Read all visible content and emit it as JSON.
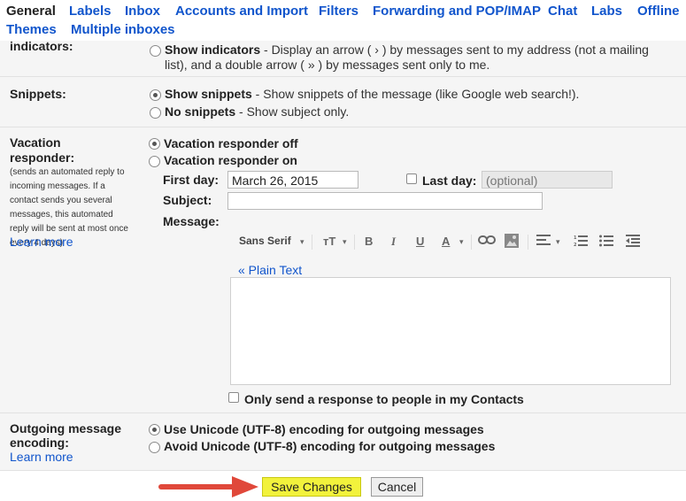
{
  "tabs": [
    {
      "label": "General",
      "active": true
    },
    {
      "label": "Labels"
    },
    {
      "label": "Inbox"
    },
    {
      "label": "Accounts and Import"
    },
    {
      "label": "Filters"
    },
    {
      "label": "Forwarding and POP/IMAP"
    },
    {
      "label": "Chat"
    },
    {
      "label": "Labs"
    },
    {
      "label": "Offline"
    },
    {
      "label": "Themes"
    },
    {
      "label": "Multiple inboxes"
    }
  ],
  "indicators": {
    "label": "indicators:",
    "option_title": "Show indicators",
    "option_desc_line1": " - Display an arrow ( › ) by messages sent to my address (not a mailing",
    "option_desc_line2": "list), and a double arrow ( » ) by messages sent only to me."
  },
  "snippets": {
    "label": "Snippets:",
    "show_title": "Show snippets",
    "show_desc": " - Show snippets of the message (like Google web search!).",
    "no_title": "No snippets",
    "no_desc": " - Show subject only."
  },
  "vacation": {
    "label_line1": "Vacation",
    "label_line2": "responder:",
    "help": "(sends an automated reply to incoming messages. If a contact sends you several messages, this automated reply will be sent at most once every 4 days)",
    "learn_more": "Learn more",
    "off_label": "Vacation responder off",
    "on_label": "Vacation responder on",
    "first_day_label": "First day:",
    "first_day_value": "March 26, 2015",
    "last_day_label": "Last day:",
    "last_day_placeholder": "(optional)",
    "subject_label": "Subject:",
    "subject_value": "",
    "message_label": "Message:",
    "font_name": "Sans Serif",
    "plain_text_link": "« Plain Text",
    "contacts_only_label": "Only send a response to people in my Contacts"
  },
  "encoding": {
    "label_line1": "Outgoing message",
    "label_line2": "encoding:",
    "learn_more": "Learn more",
    "use_unicode": "Use Unicode (UTF-8) encoding for outgoing messages",
    "avoid_unicode": "Avoid Unicode (UTF-8) encoding for outgoing messages"
  },
  "actions": {
    "save": "Save Changes",
    "cancel": "Cancel"
  },
  "colors": {
    "link": "#1155cc",
    "row_bg": "#f5f5f5",
    "save_highlight": "#f2f23c",
    "arrow": "#e0483a"
  }
}
